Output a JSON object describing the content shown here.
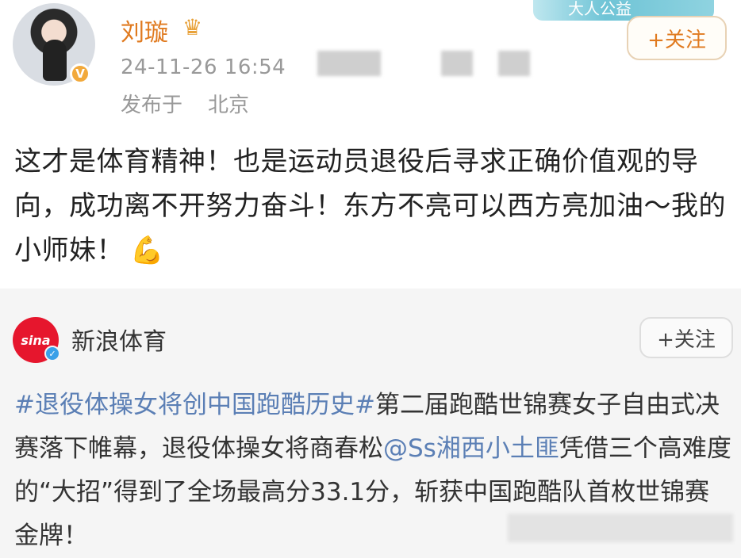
{
  "post": {
    "author": "刘璇",
    "crown_icon": "crown-icon",
    "verified_badge": "V",
    "timestamp": "24-11-26 16:54",
    "location_prefix": "发布于",
    "location": "北京",
    "banner_text": "大人公益",
    "follow_label": "+关注",
    "text": "这才是体育精神！也是运动员退役后寻求正确价值观的导向，成功离不开努力奋斗！东方不亮可以西方亮加油～我的小师妹！",
    "emoji": "💪"
  },
  "repost": {
    "author": "新浪体育",
    "logo_text": "sina",
    "follow_label": "+关注",
    "hashtag": "#退役体操女将创中国跑酷历史#",
    "text_part1": "第二届跑酷世锦赛女子自由式决赛落下帷幕，退役体操女将商春松",
    "mention": "@Ss湘西小土匪",
    "text_part2": "凭借三个高难度的“大招”得到了全场最高分33.1分，斩获中国跑酷队首枚世锦赛金牌！"
  },
  "colors": {
    "author_orange": "#e07a1f",
    "link_blue": "#5b7fb5",
    "repost_bg": "#f5f5f5"
  }
}
